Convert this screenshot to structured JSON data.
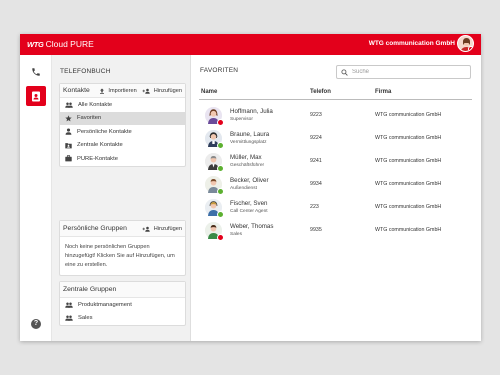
{
  "brand": {
    "prefix": "WTG",
    "name": "Cloud PURE"
  },
  "header": {
    "company": "WTG communication GmbH"
  },
  "colors": {
    "accent": "#e3001b",
    "available": "#5cb030",
    "busy": "#e3001b"
  },
  "rail": {
    "items": [
      {
        "icon": "phone-icon"
      },
      {
        "icon": "contacts-book-icon"
      },
      {
        "icon": "help-icon",
        "label": "?"
      }
    ]
  },
  "left": {
    "title": "TELEFONBUCH",
    "contacts": {
      "heading": "Kontakte",
      "import_label": "Importieren",
      "add_label": "Hinzufügen",
      "items": [
        {
          "label": "Alle Kontakte",
          "icon": "group-icon"
        },
        {
          "label": "Favoriten",
          "icon": "star-icon"
        },
        {
          "label": "Persönliche Kontakte",
          "icon": "person-icon"
        },
        {
          "label": "Zentrale Kontakte",
          "icon": "folder-contacts-icon"
        },
        {
          "label": "PURE-Kontakte",
          "icon": "briefcase-icon"
        }
      ]
    },
    "personal_groups": {
      "heading": "Persönliche Gruppen",
      "add_label": "Hinzufügen",
      "empty_text": "Noch keine persönlichen Gruppen hinzugefügt! Klicken Sie auf Hinzufügen, um eine zu erstellen."
    },
    "central_groups": {
      "heading": "Zentrale Gruppen",
      "items": [
        {
          "label": "Produktmanagement",
          "icon": "group-icon"
        },
        {
          "label": "Sales",
          "icon": "group-icon"
        }
      ]
    }
  },
  "main": {
    "title": "FAVORITEN",
    "search": {
      "placeholder": "Suche",
      "value": ""
    },
    "columns": [
      "Name",
      "Telefon",
      "Firma"
    ],
    "rows": [
      {
        "name": "Hoffmann, Julia",
        "role": "Supervisor",
        "phone": "9223",
        "company": "WTG communication GmbH",
        "status": "busy"
      },
      {
        "name": "Braune, Laura",
        "role": "Vermittlungsplatz",
        "phone": "9224",
        "company": "WTG communication GmbH",
        "status": "available"
      },
      {
        "name": "Müller, Max",
        "role": "Geschäftsführer",
        "phone": "9241",
        "company": "WTG communication GmbH",
        "status": "available"
      },
      {
        "name": "Becker, Oliver",
        "role": "Außendienst",
        "phone": "9934",
        "company": "WTG communication GmbH",
        "status": "available"
      },
      {
        "name": "Fischer, Sven",
        "role": "Call Center Agent",
        "phone": "223",
        "company": "WTG communication GmbH",
        "status": "available"
      },
      {
        "name": "Weber, Thomas",
        "role": "Sales",
        "phone": "9935",
        "company": "WTG communication GmbH",
        "status": "busy"
      }
    ]
  }
}
